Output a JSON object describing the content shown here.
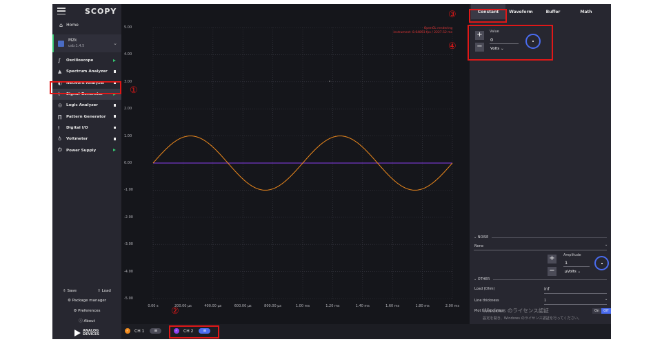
{
  "app": {
    "logo": "SCOPY",
    "home": "Home"
  },
  "device": {
    "name": "M2k",
    "uri": "usb:1.4.5"
  },
  "tools": [
    {
      "label": "Oscilloscope",
      "icon": "oscilloscope-icon",
      "state": "run"
    },
    {
      "label": "Spectrum Analyzer",
      "icon": "spectrum-icon",
      "state": "stop"
    },
    {
      "label": "Network Analyzer",
      "icon": "network-icon",
      "state": "stop"
    },
    {
      "label": "Signal Generator",
      "icon": "signal-generator-icon",
      "state": "run"
    },
    {
      "label": "Logic Analyzer",
      "icon": "logic-icon",
      "state": "stop"
    },
    {
      "label": "Pattern Generator",
      "icon": "pattern-icon",
      "state": "stop"
    },
    {
      "label": "Digital I/O",
      "icon": "digital-io-icon",
      "state": "stop"
    },
    {
      "label": "Voltmeter",
      "icon": "voltmeter-icon",
      "state": "stop"
    },
    {
      "label": "Power Supply",
      "icon": "power-icon",
      "state": "run"
    }
  ],
  "sidebar_bottom": {
    "save": "Save",
    "load": "Load",
    "package_manager": "Package manager",
    "preferences": "Preferences",
    "about": "About",
    "brand_line1": "ANALOG",
    "brand_line2": "DEVICES"
  },
  "plot": {
    "y_ticks": [
      "5.00",
      "4.00",
      "3.00",
      "2.00",
      "1.00",
      "0.00",
      "-1.00",
      "-2.00",
      "-3.00",
      "-4.00",
      "-5.00"
    ],
    "x_ticks": [
      "0.00 s",
      "200.00 µs",
      "400.00 µs",
      "600.00 µs",
      "800.00 µs",
      "1.00 ms",
      "1.20 ms",
      "1.40 ms",
      "1.60 ms",
      "1.80 ms",
      "2.00 ms"
    ],
    "overlay_line1": "OpenGL rendering",
    "overlay_line2": "instrument: 8.64893 fps / 2227.52 ms",
    "colors": {
      "ch1": "#f08a1c",
      "ch2": "#8a3ff0"
    }
  },
  "chart_data": {
    "type": "line",
    "xlim": [
      0,
      2.0
    ],
    "ylim": [
      -5,
      5
    ],
    "series": [
      {
        "name": "CH 1",
        "x": [
          0.0,
          0.2,
          0.4,
          0.6,
          0.8,
          1.0,
          1.2,
          1.4,
          1.6,
          1.8,
          2.0
        ],
        "values": [
          0.0,
          0.95,
          0.59,
          -0.59,
          -0.95,
          0.0,
          0.95,
          0.59,
          -0.59,
          -0.95,
          0.0
        ]
      },
      {
        "name": "CH 2",
        "x": [
          0.0,
          2.0
        ],
        "values": [
          0.0,
          0.0
        ]
      }
    ]
  },
  "channels": [
    {
      "label": "CH 1",
      "color": "#f08a1c"
    },
    {
      "label": "CH 2",
      "color": "#8a3ff0"
    }
  ],
  "right_panel": {
    "tabs": [
      "Constant",
      "Waveform",
      "Buffer",
      "Math"
    ],
    "value_label": "Value",
    "value": "0",
    "value_unit": "Volts",
    "noise_label": "NOISE",
    "noise_type": "None",
    "amplitude_label": "Amplitude",
    "amplitude": "1",
    "amplitude_unit": "µVolts",
    "other_label": "OTHER",
    "load_label": "Load (Ohm)",
    "load_value": "inf",
    "line_thickness_label": "Line thickness",
    "line_thickness_value": "1",
    "plot_label": "Plot Interpolation",
    "toggle_on": "On",
    "toggle_off": "Off"
  },
  "watermark": {
    "line1": "Windows のライセンス認証",
    "line2": "設定を開き、Windows のライセンス認証を行ってください。"
  },
  "annotations": [
    "①",
    "②",
    "③",
    "④"
  ]
}
